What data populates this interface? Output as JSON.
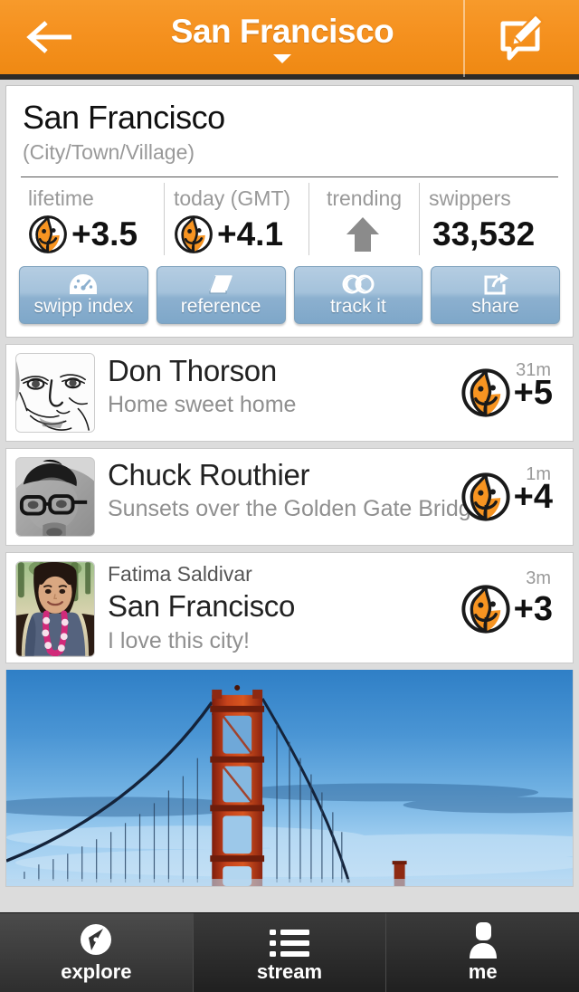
{
  "header": {
    "title": "San Francisco",
    "back_icon": "arrow-left-icon",
    "caret_icon": "chevron-down-icon",
    "compose_icon": "compose-speech-bubble-icon",
    "accent": "#f5911f"
  },
  "summary": {
    "title": "San Francisco",
    "subtitle": "(City/Town/Village)",
    "stats": [
      {
        "label": "lifetime",
        "value": "+3.5",
        "icon": "swipp-logo-icon"
      },
      {
        "label": "today (GMT)",
        "value": "+4.1",
        "icon": "swipp-logo-icon"
      },
      {
        "label": "trending",
        "value": "",
        "icon": "arrow-up-icon"
      },
      {
        "label": "swippers",
        "value": "33,532",
        "icon": ""
      }
    ],
    "actions": [
      {
        "label": "swipp index",
        "icon": "gauge-icon"
      },
      {
        "label": "reference",
        "icon": "book-icon"
      },
      {
        "label": "track it",
        "icon": "binoculars-icon"
      },
      {
        "label": "share",
        "icon": "share-icon"
      }
    ]
  },
  "feed": [
    {
      "name": "Don Thorson",
      "message": "Home sweet home",
      "time": "31m",
      "score": "+5",
      "avatar": "sketch-portrait-avatar",
      "layout": "name-first"
    },
    {
      "name": "Chuck Routhier",
      "message": "Sunsets over the Golden Gate Bridge!",
      "time": "1m",
      "score": "+4",
      "avatar": "glasses-portrait-avatar",
      "layout": "name-first"
    },
    {
      "name": "Fatima Saldivar",
      "place": "San Francisco",
      "message": "I love this city!",
      "time": "3m",
      "score": "+3",
      "avatar": "woman-portrait-avatar",
      "layout": "place-main"
    }
  ],
  "photo": {
    "alt": "Golden Gate Bridge at dusk"
  },
  "tabbar": {
    "tabs": [
      {
        "label": "explore",
        "icon": "compass-icon",
        "active": true
      },
      {
        "label": "stream",
        "icon": "list-icon",
        "active": false
      },
      {
        "label": "me",
        "icon": "person-icon",
        "active": false
      }
    ]
  },
  "colors": {
    "orange": "#f5911f",
    "logo_orange": "#f79421",
    "button_blue": "#9dbcd6"
  }
}
